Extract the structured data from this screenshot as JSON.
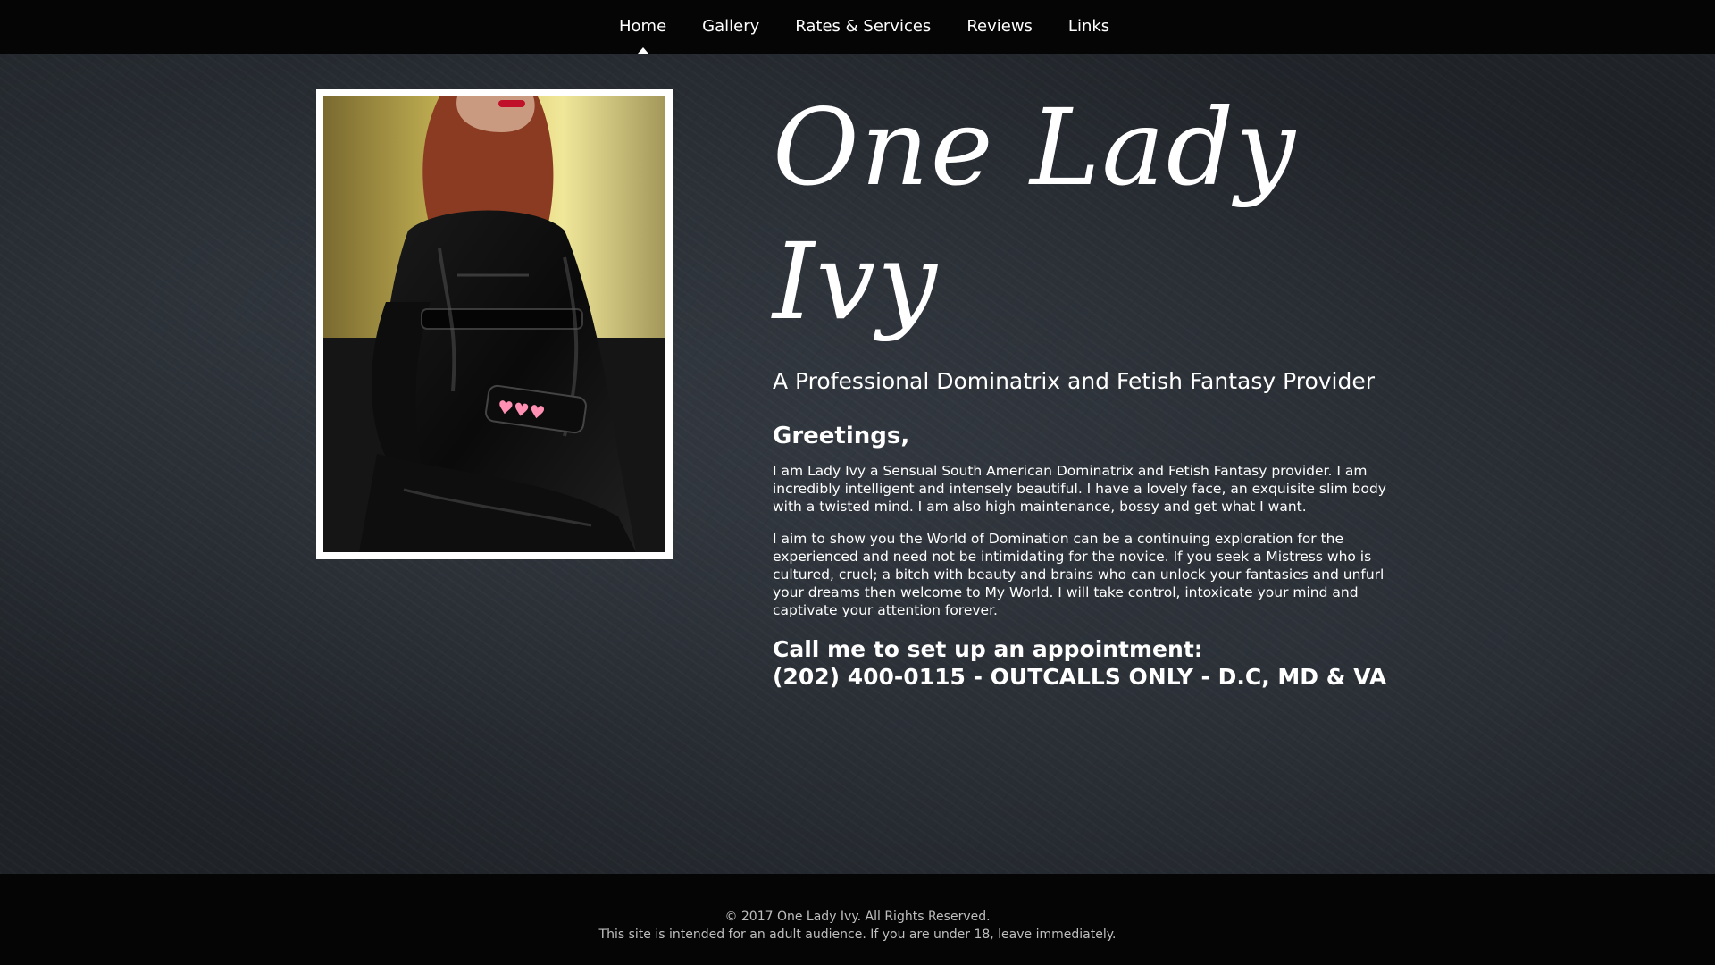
{
  "nav": {
    "items": [
      {
        "label": "Home",
        "active": true
      },
      {
        "label": "Gallery"
      },
      {
        "label": "Rates & Services"
      },
      {
        "label": "Reviews"
      },
      {
        "label": "Links"
      }
    ]
  },
  "hero": {
    "title": "One Lady Ivy",
    "tagline": "A Professional Dominatrix and Fetish Fantasy Provider"
  },
  "main": {
    "greeting": "Greetings,",
    "paragraphs": [
      "I am Lady Ivy a Sensual South American Dominatrix and Fetish Fantasy provider. I am incredibly intelligent and intensely beautiful. I have a lovely face, an exquisite slim body with a twisted mind. I am also high maintenance, bossy and get what I want.",
      "I aim to show you the World of Domination can be a continuing exploration for the experienced and need not be intimidating for the novice. If you seek a Mistress who is cultured, cruel; a bitch with beauty and brains who can unlock your fantasies and unfurl your dreams then welcome to My World. I will take control, intoxicate your mind and captivate your attention forever."
    ],
    "cta_line1": "Call me to set up an appointment:",
    "cta_line2": "(202) 400-0115 - OUTCALLS ONLY - D.C, MD & VA"
  },
  "footer": {
    "copyright": "© 2017 One Lady Ivy. All Rights Reserved.",
    "notice": "This site is intended for an adult audience. If you are under 18, leave immediately."
  },
  "colors": {
    "nav_bg": "#050505",
    "page_bg": "#23272d",
    "text": "#ffffff",
    "footer_text": "#bfbfbf"
  }
}
